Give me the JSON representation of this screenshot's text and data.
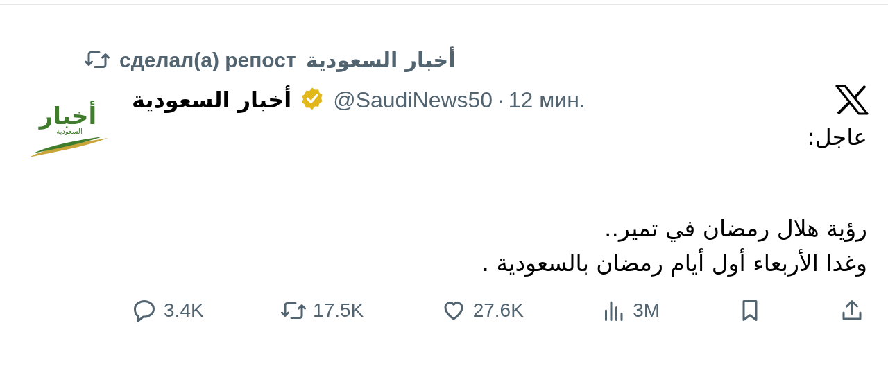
{
  "repost": {
    "label": "сделал(а) репост",
    "reposter": "أخبار السعودية"
  },
  "author": {
    "name": "أخبار السعودية",
    "verified": true,
    "handle": "@SaudiNews50",
    "separator": "·",
    "time": "12 мин.",
    "avatar_text": [
      "أخبار",
      "السعودية"
    ]
  },
  "body": [
    "عاجل:",
    "رؤية هلال رمضان في تمير..\nوغدا الأربعاء أول أيام رمضان بالسعودية ."
  ],
  "actions": [
    {
      "kind": "share"
    },
    {
      "kind": "bookmark"
    },
    {
      "kind": "views",
      "count": "3M"
    },
    {
      "kind": "like",
      "count": "27.6K"
    },
    {
      "kind": "repost",
      "count": "17.5K"
    },
    {
      "kind": "reply",
      "count": "3.4K"
    }
  ]
}
